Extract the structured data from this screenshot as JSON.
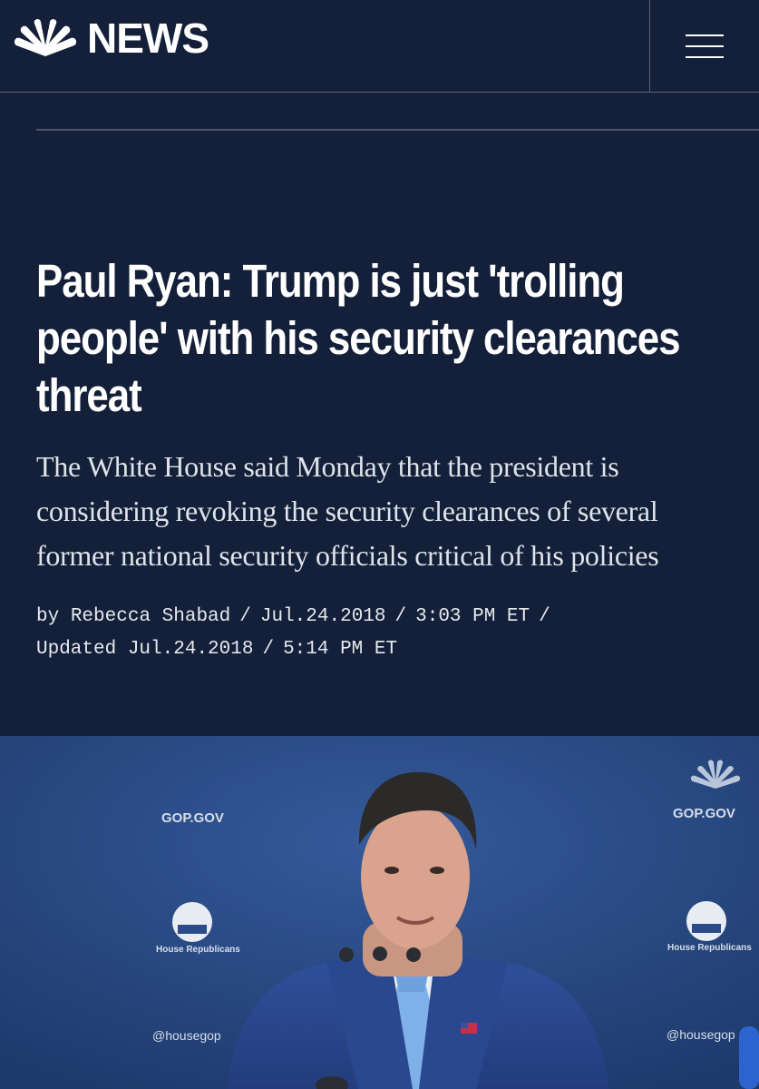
{
  "header": {
    "brand": "NEWS",
    "logo_icon": "nbc-peacock-icon",
    "menu_icon": "hamburger-menu-icon"
  },
  "article": {
    "headline": "Paul Ryan: Trump is just 'trolling people' with his security clearances threat",
    "dek": "The White House said Monday that the president is considering revoking the security clearances of several former national security officials critical of his policies",
    "byline_prefix": "by",
    "author": "Rebecca Shabad",
    "date": "Jul.24.2018",
    "time": "3:03 PM ET",
    "updated_label": "Updated",
    "updated_date": "Jul.24.2018",
    "updated_time": "5:14 PM ET"
  },
  "photo": {
    "backdrop_texts": [
      "GOP.GOV",
      "GOP.GOV",
      "House Republicans",
      "House Republicans",
      "@housegop",
      "@housegop"
    ]
  },
  "colors": {
    "background": "#142039",
    "divider": "#5b6478",
    "backdrop": "#274a86"
  }
}
